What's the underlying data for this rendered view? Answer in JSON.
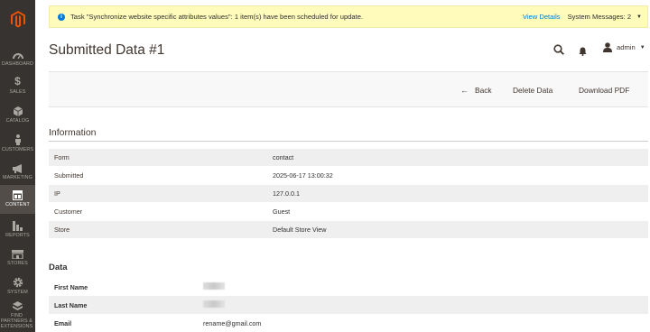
{
  "sidebar": {
    "items": [
      {
        "label": "DASHBOARD",
        "icon": "dashboard-icon"
      },
      {
        "label": "SALES",
        "icon": "dollar-icon"
      },
      {
        "label": "CATALOG",
        "icon": "cube-icon"
      },
      {
        "label": "CUSTOMERS",
        "icon": "person-icon"
      },
      {
        "label": "MARKETING",
        "icon": "megaphone-icon"
      },
      {
        "label": "CONTENT",
        "icon": "layout-icon"
      },
      {
        "label": "REPORTS",
        "icon": "bar-chart-icon"
      },
      {
        "label": "STORES",
        "icon": "store-icon"
      },
      {
        "label": "SYSTEM",
        "icon": "gear-icon"
      },
      {
        "label": "FIND PARTNERS & EXTENSIONS",
        "icon": "boxes-icon"
      }
    ]
  },
  "notice": {
    "message": "Task \"Synchronize website specific attributes values\": 1 item(s) have been scheduled for update.",
    "view_details": "View Details",
    "system_messages": "System Messages: 2"
  },
  "header": {
    "title": "Submitted Data #1",
    "user": "admin"
  },
  "actions": {
    "back": "Back",
    "delete": "Delete Data",
    "download": "Download PDF"
  },
  "information": {
    "title": "Information",
    "rows": [
      {
        "label": "Form",
        "value": "contact"
      },
      {
        "label": "Submitted",
        "value": "2025-06-17 13:00:32"
      },
      {
        "label": "IP",
        "value": "127.0.0.1"
      },
      {
        "label": "Customer",
        "value": "Guest"
      },
      {
        "label": "Store",
        "value": "Default Store View"
      }
    ]
  },
  "data": {
    "title": "Data",
    "rows": [
      {
        "label": "First Name",
        "value": ""
      },
      {
        "label": "Last Name",
        "value": ""
      },
      {
        "label": "Email",
        "value": "rename@gmail.com"
      }
    ]
  },
  "colors": {
    "sidebar_bg": "#373330",
    "notice_bg": "#fffbbb",
    "link": "#007bdb",
    "logo": "#eb5202"
  }
}
